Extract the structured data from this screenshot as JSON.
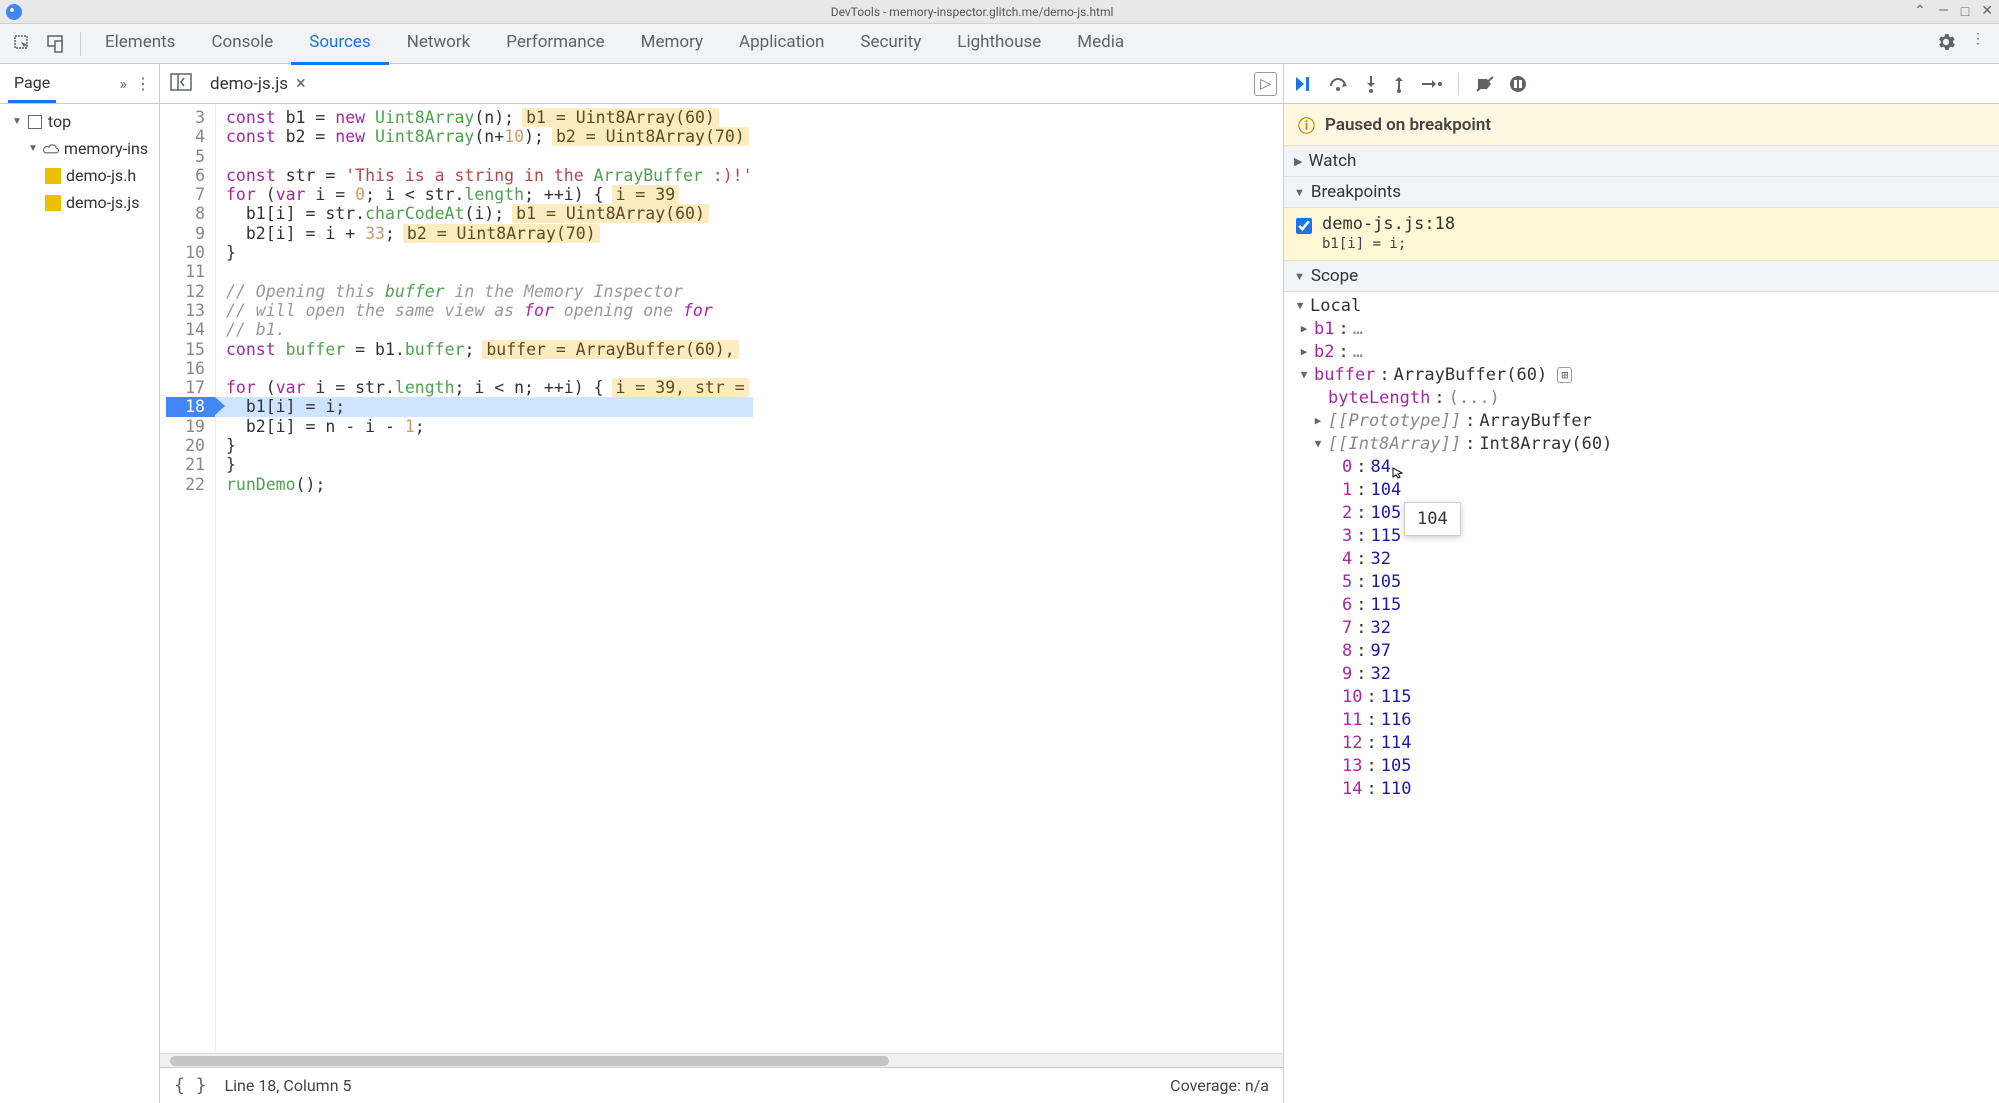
{
  "titlebar": {
    "title": "DevTools - memory-inspector.glitch.me/demo-js.html"
  },
  "tabs": [
    "Elements",
    "Console",
    "Sources",
    "Network",
    "Performance",
    "Memory",
    "Application",
    "Security",
    "Lighthouse",
    "Media"
  ],
  "activeTab": "Sources",
  "sidebar": {
    "header": "Page",
    "items": [
      {
        "label": "top",
        "icon": "frame",
        "depth": 0,
        "expanded": true
      },
      {
        "label": "memory-ins",
        "icon": "cloud",
        "depth": 1,
        "expanded": true
      },
      {
        "label": "demo-js.h",
        "icon": "js",
        "depth": 2,
        "truncated": true
      },
      {
        "label": "demo-js.js",
        "icon": "js",
        "depth": 2,
        "truncated": true
      }
    ]
  },
  "fileTab": {
    "name": "demo-js.js"
  },
  "editor": {
    "startLine": 3,
    "hlLine": 18,
    "lines": [
      {
        "n": 3,
        "raw": "const b1 = new Uint8Array(n);",
        "inline": "b1 = Uint8Array(60)"
      },
      {
        "n": 4,
        "raw": "const b2 = new Uint8Array(n+10);",
        "inline": "b2 = Uint8Array(70)"
      },
      {
        "n": 5,
        "raw": ""
      },
      {
        "n": 6,
        "raw": "const str = 'This is a string in the ArrayBuffer :)!'"
      },
      {
        "n": 7,
        "raw": "for (var i = 0; i < str.length; ++i) {",
        "inline": "i = 39"
      },
      {
        "n": 8,
        "raw": "  b1[i] = str.charCodeAt(i);",
        "inline": "b1 = Uint8Array(60)"
      },
      {
        "n": 9,
        "raw": "  b2[i] = i + 33;",
        "inline": "b2 = Uint8Array(70)"
      },
      {
        "n": 10,
        "raw": "}"
      },
      {
        "n": 11,
        "raw": ""
      },
      {
        "n": 12,
        "raw": "// Opening this buffer in the Memory Inspector"
      },
      {
        "n": 13,
        "raw": "// will open the same view as for opening one for"
      },
      {
        "n": 14,
        "raw": "// b1."
      },
      {
        "n": 15,
        "raw": "const buffer = b1.buffer;",
        "inline": "buffer = ArrayBuffer(60),"
      },
      {
        "n": 16,
        "raw": ""
      },
      {
        "n": 17,
        "raw": "for (var i = str.length; i < n; ++i) {",
        "inline": "i = 39, str ="
      },
      {
        "n": 18,
        "raw": "  b1[i] = i;"
      },
      {
        "n": 19,
        "raw": "  b2[i] = n - i - 1;"
      },
      {
        "n": 20,
        "raw": "}"
      },
      {
        "n": 21,
        "raw": "}"
      },
      {
        "n": 22,
        "raw": "runDemo();"
      }
    ]
  },
  "statusbar": {
    "position": "Line 18, Column 5",
    "coverage": "Coverage: n/a"
  },
  "debugger": {
    "paused": "Paused on breakpoint",
    "sections": {
      "watch": "Watch",
      "breakpoints": "Breakpoints",
      "scope": "Scope"
    },
    "breakpoint": {
      "file": "demo-js.js:18",
      "code": "b1[i] = i;",
      "checked": true
    },
    "scope": {
      "local": "Local",
      "b1": "…",
      "b2": "…",
      "buffer": {
        "label": "buffer",
        "type": "ArrayBuffer(60)",
        "byteLength": "(...)",
        "proto": "ArrayBuffer",
        "int8": "Int8Array(60)"
      },
      "arrayValues": [
        84,
        104,
        105,
        115,
        32,
        105,
        115,
        32,
        97,
        32,
        115,
        116,
        114,
        105,
        110
      ]
    },
    "tooltip": "104"
  }
}
